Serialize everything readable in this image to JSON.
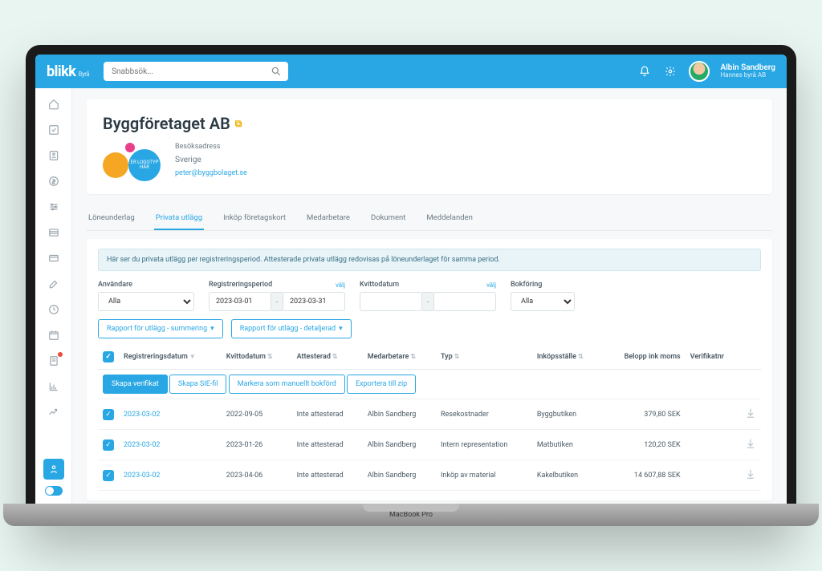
{
  "brand": {
    "name": "blikk",
    "suffix": "Byrå"
  },
  "search": {
    "placeholder": "Snabbsök..."
  },
  "user": {
    "name": "Albin Sandberg",
    "org": "Hannes byrå AB"
  },
  "company": {
    "name": "Byggföretaget AB",
    "address_label": "Besöksadress",
    "country": "Sverige",
    "email": "peter@byggbolaget.se",
    "logo_text": "ER LOGOTYP HÄR"
  },
  "tabs": [
    {
      "label": "Löneunderlag",
      "active": false
    },
    {
      "label": "Privata utlägg",
      "active": true
    },
    {
      "label": "Inköp företagskort",
      "active": false
    },
    {
      "label": "Medarbetare",
      "active": false
    },
    {
      "label": "Dokument",
      "active": false
    },
    {
      "label": "Meddelanden",
      "active": false
    }
  ],
  "info_banner": "Här ser du privata utlägg per registreringsperiod. Attesterade privata utlägg redovisas på löneunderlaget för samma period.",
  "filters": {
    "user_label": "Användare",
    "user_value": "Alla",
    "period_label": "Registreringsperiod",
    "period_from": "2023-03-01",
    "period_to": "2023-03-31",
    "receipt_label": "Kvittodatum",
    "booking_label": "Bokföring",
    "booking_value": "Alla",
    "choose": "välj"
  },
  "report_buttons": {
    "summary": "Rapport för utlägg - summering",
    "detail": "Rapport för utlägg - detaljerad"
  },
  "columns": {
    "reg": "Registreringsdatum",
    "receipt": "Kvittodatum",
    "attest": "Attesterad",
    "employee": "Medarbetare",
    "type": "Typ",
    "store": "Inköpsställe",
    "amount": "Belopp ink moms",
    "verif": "Verifikatnr"
  },
  "action_buttons": {
    "create": "Skapa verifikat",
    "sie": "Skapa SIE-fil",
    "manual": "Markera som manuellt bokförd",
    "export": "Exportera till zip"
  },
  "rows": [
    {
      "reg": "2023-03-02",
      "receipt": "2022-09-05",
      "attest": "Inte attesterad",
      "employee": "Albin Sandberg",
      "type": "Resekostnader",
      "store": "Byggbutiken",
      "amount": "379,80 SEK"
    },
    {
      "reg": "2023-03-02",
      "receipt": "2023-01-26",
      "attest": "Inte attesterad",
      "employee": "Albin Sandberg",
      "type": "Intern representation",
      "store": "Matbutiken",
      "amount": "120,20 SEK"
    },
    {
      "reg": "2023-03-02",
      "receipt": "2023-04-06",
      "attest": "Inte attesterad",
      "employee": "Albin Sandberg",
      "type": "Inköp av material",
      "store": "Kakelbutiken",
      "amount": "14 607,88 SEK"
    }
  ],
  "laptop": "MacBook Pro"
}
